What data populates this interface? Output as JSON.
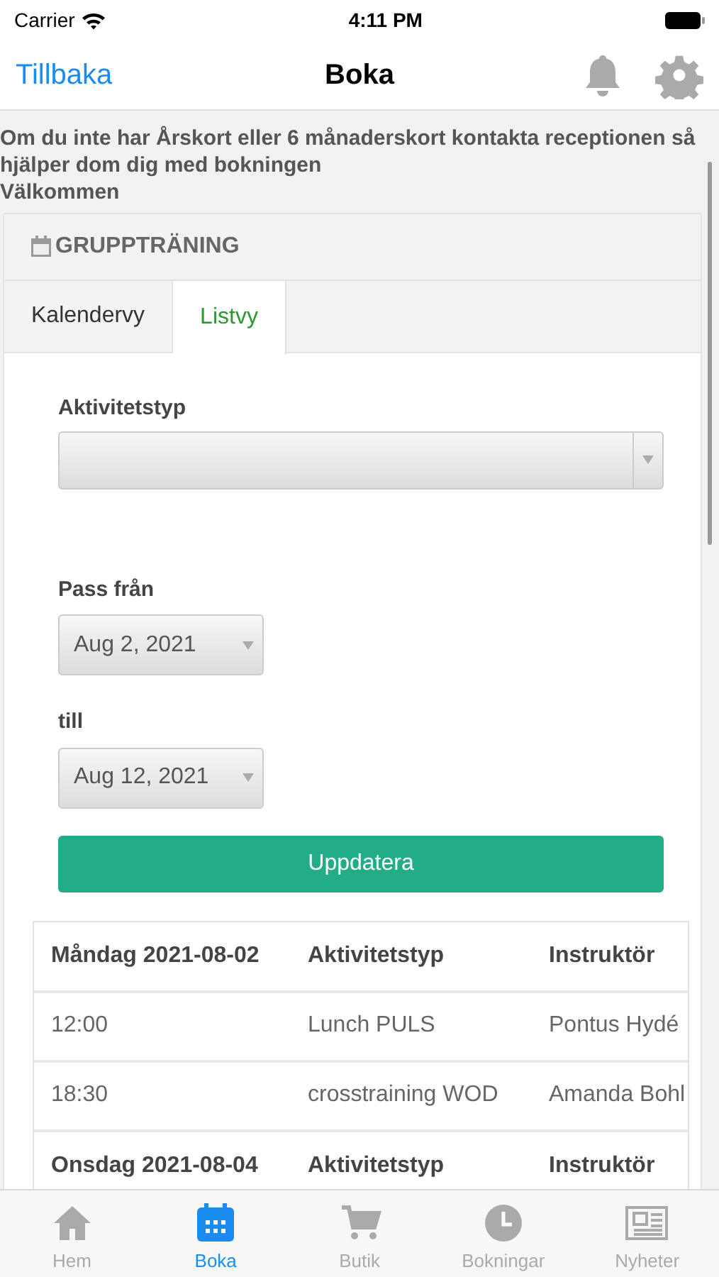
{
  "status_bar": {
    "carrier": "Carrier",
    "time": "4:11 PM"
  },
  "nav": {
    "back": "Tillbaka",
    "title": "Boka"
  },
  "notice": [
    "Om du inte har Årskort eller 6 månaderskort kontakta receptionen så hjälper dom dig med bokningen",
    "Välkommen"
  ],
  "panel": {
    "title": "GRUPPTRÄNING"
  },
  "tabs": [
    {
      "label": "Kalendervy",
      "selected": false
    },
    {
      "label": "Listvy",
      "selected": true
    }
  ],
  "form": {
    "activity_label": "Aktivitetstyp",
    "from_label": "Pass från",
    "from_value": "Aug 2, 2021",
    "to_label": "till",
    "to_value": "Aug 12, 2021",
    "button": "Uppdatera"
  },
  "table": {
    "rows": [
      {
        "kind": "header",
        "cells": [
          "Måndag 2021-08-02",
          "Aktivitetstyp",
          "Instruktör"
        ]
      },
      {
        "kind": "session",
        "cells": [
          "12:00",
          "Lunch PULS",
          "Pontus Hydé"
        ]
      },
      {
        "kind": "session",
        "cells": [
          "18:30",
          "crosstraining WOD",
          "Amanda Bohl"
        ]
      },
      {
        "kind": "header",
        "cells": [
          "Onsdag 2021-08-04",
          "Aktivitetstyp",
          "Instruktör"
        ]
      }
    ]
  },
  "tab_bar": [
    {
      "label": "Hem",
      "kind": "home",
      "selected": false
    },
    {
      "label": "Boka",
      "kind": "calendar",
      "selected": true
    },
    {
      "label": "Butik",
      "kind": "cart",
      "selected": false
    },
    {
      "label": "Bokningar",
      "kind": "clock",
      "selected": false
    },
    {
      "label": "Nyheter",
      "kind": "news",
      "selected": false
    }
  ]
}
